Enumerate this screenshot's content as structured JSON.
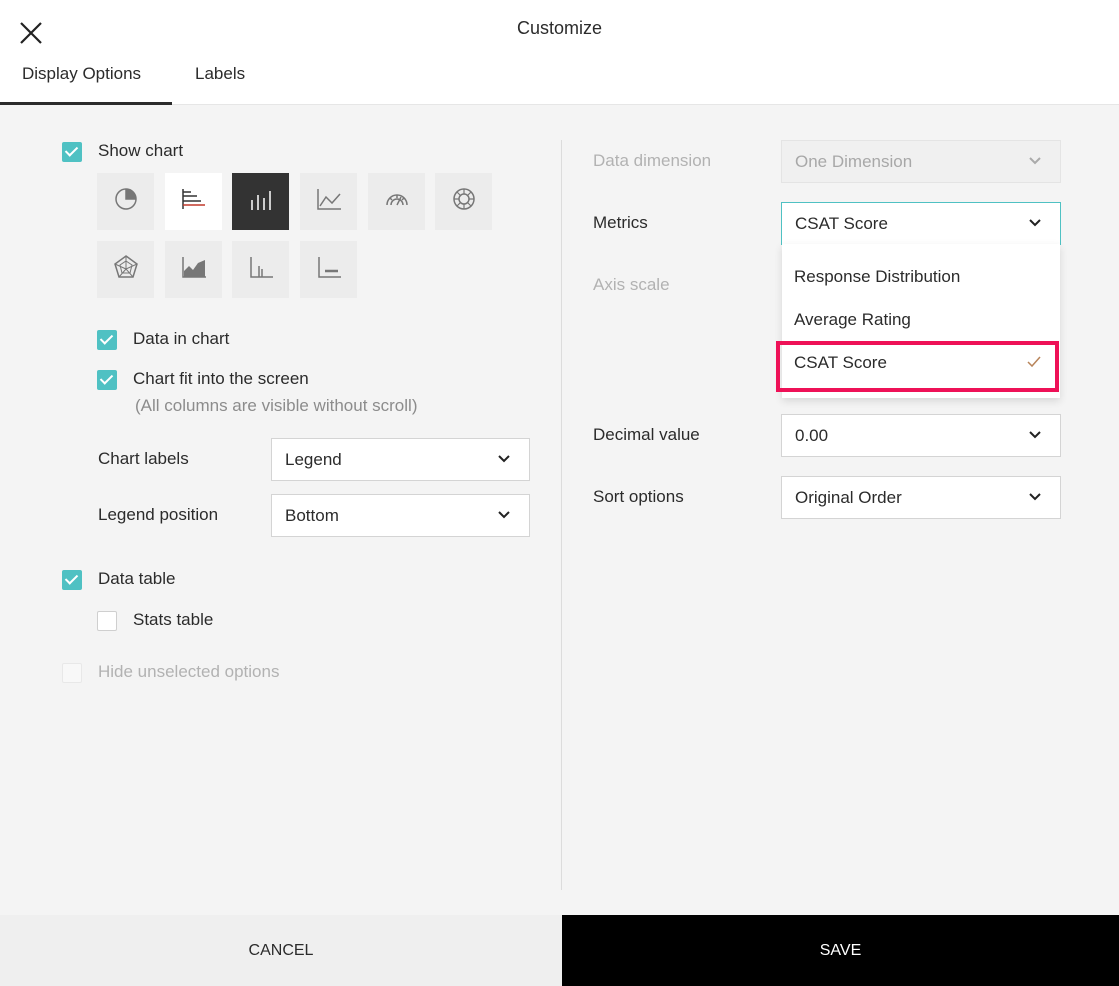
{
  "header": {
    "title": "Customize",
    "tabs": [
      {
        "label": "Display Options",
        "active": true
      },
      {
        "label": "Labels",
        "active": false
      }
    ]
  },
  "left": {
    "show_chart": {
      "label": "Show chart",
      "checked": true
    },
    "chart_types": [
      {
        "icon": "pie-chart-icon",
        "selected": false
      },
      {
        "icon": "horizontal-bar-chart-icon",
        "selected": false
      },
      {
        "icon": "vertical-bar-chart-icon",
        "selected": true
      },
      {
        "icon": "line-chart-icon",
        "selected": false
      },
      {
        "icon": "gauge-chart-icon",
        "selected": false
      },
      {
        "icon": "donut-chart-icon",
        "selected": false
      },
      {
        "icon": "radar-chart-icon",
        "selected": false
      },
      {
        "icon": "area-chart-icon",
        "selected": false
      },
      {
        "icon": "column-chart-icon",
        "selected": false
      },
      {
        "icon": "floating-bar-chart-icon",
        "selected": false
      }
    ],
    "data_in_chart": {
      "label": "Data in chart",
      "checked": true
    },
    "chart_fit": {
      "label": "Chart fit into the screen",
      "hint": "(All columns are visible without scroll)",
      "checked": true
    },
    "chart_labels": {
      "label": "Chart labels",
      "value": "Legend"
    },
    "legend_position": {
      "label": "Legend position",
      "value": "Bottom"
    },
    "data_table": {
      "label": "Data table",
      "checked": true
    },
    "stats_table": {
      "label": "Stats table",
      "checked": false
    },
    "hide_unselected": {
      "label": "Hide unselected options",
      "checked": false,
      "disabled": true
    }
  },
  "right": {
    "data_dimension": {
      "label": "Data dimension",
      "value": "One Dimension",
      "disabled": true
    },
    "metrics": {
      "label": "Metrics",
      "value": "CSAT Score",
      "open": true
    },
    "metrics_options": [
      {
        "label": "Response Distribution"
      },
      {
        "label": "Average Rating"
      },
      {
        "label": "CSAT Score",
        "selected": true
      }
    ],
    "axis_scale": {
      "label": "Axis scale"
    },
    "decimal_value": {
      "label": "Decimal value",
      "value": "0.00"
    },
    "sort_options": {
      "label": "Sort options",
      "value": "Original Order"
    }
  },
  "footer": {
    "cancel": "CANCEL",
    "save": "SAVE"
  },
  "colors": {
    "accent": "#4fc1c3",
    "highlight": "#ee1157",
    "save_bg": "#000000"
  }
}
